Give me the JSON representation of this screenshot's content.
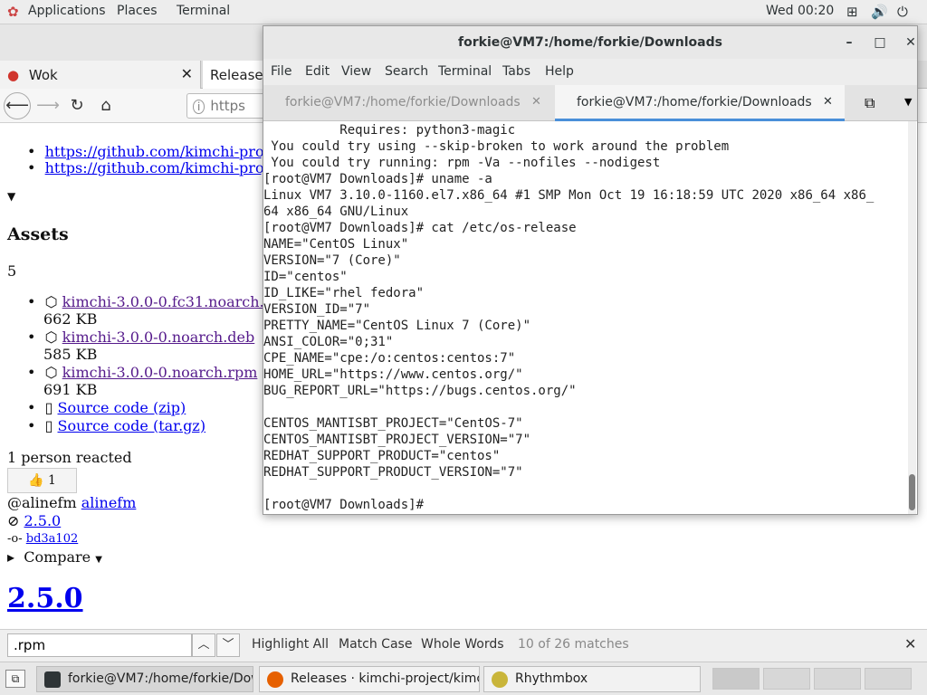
{
  "topbar": {
    "applications": "Applications",
    "places": "Places",
    "terminal": "Terminal",
    "clock": "Wed 00:20",
    "icons": [
      "network-icon",
      "volume-icon",
      "power-icon"
    ]
  },
  "browser": {
    "tabs": [
      {
        "label": "Wok"
      },
      {
        "label": "Releases"
      }
    ],
    "url_partial": "https",
    "content": {
      "links_top": [
        "https://github.com/kimchi-proj",
        "https://github.com/kimchi-proj"
      ],
      "assets_heading": "Assets",
      "assets_count": "5",
      "assets": [
        {
          "name": "kimchi-3.0.0-0.fc31.noarch.",
          "size": "662 KB"
        },
        {
          "name": "kimchi-3.0.0-0.noarch.deb",
          "size": "585 KB"
        },
        {
          "name": "kimchi-3.0.0-0.noarch.rpm",
          "size": "691 KB"
        }
      ],
      "source_zip": "Source code (zip)",
      "source_tar": "Source code (tar.gz)",
      "reacted": "1 person reacted",
      "reaction": "👍 1",
      "author_handle": "@alinefm",
      "author_link": "alinefm",
      "tag": "2.5.0",
      "commit": "bd3a102",
      "compare": "Compare",
      "release_heading": "2.5.0"
    }
  },
  "findbar": {
    "query": ".rpm",
    "highlight_all": "Highlight All",
    "match_case": "Match Case",
    "whole_words": "Whole Words",
    "matches": "10 of 26 matches"
  },
  "taskbar": {
    "tasks": [
      {
        "label": "forkie@VM7:/home/forkie/Dow...",
        "active": true
      },
      {
        "label": "Releases · kimchi-project/kimchi...",
        "active": false
      },
      {
        "label": "Rhythmbox",
        "active": false
      }
    ]
  },
  "terminal": {
    "title": "forkie@VM7:/home/forkie/Downloads",
    "menu": [
      "File",
      "Edit",
      "View",
      "Search",
      "Terminal",
      "Tabs",
      "Help"
    ],
    "tabs": [
      {
        "label": "forkie@VM7:/home/forkie/Downloads",
        "active": false
      },
      {
        "label": "forkie@VM7:/home/forkie/Downloads",
        "active": true
      }
    ],
    "lines": [
      "          Requires: python3-magic",
      " You could try using --skip-broken to work around the problem",
      " You could try running: rpm -Va --nofiles --nodigest",
      "[root@VM7 Downloads]# uname -a",
      "Linux VM7 3.10.0-1160.el7.x86_64 #1 SMP Mon Oct 19 16:18:59 UTC 2020 x86_64 x86_",
      "64 x86_64 GNU/Linux",
      "[root@VM7 Downloads]# cat /etc/os-release",
      "NAME=\"CentOS Linux\"",
      "VERSION=\"7 (Core)\"",
      "ID=\"centos\"",
      "ID_LIKE=\"rhel fedora\"",
      "VERSION_ID=\"7\"",
      "PRETTY_NAME=\"CentOS Linux 7 (Core)\"",
      "ANSI_COLOR=\"0;31\"",
      "CPE_NAME=\"cpe:/o:centos:centos:7\"",
      "HOME_URL=\"https://www.centos.org/\"",
      "BUG_REPORT_URL=\"https://bugs.centos.org/\"",
      "",
      "CENTOS_MANTISBT_PROJECT=\"CentOS-7\"",
      "CENTOS_MANTISBT_PROJECT_VERSION=\"7\"",
      "REDHAT_SUPPORT_PRODUCT=\"centos\"",
      "REDHAT_SUPPORT_PRODUCT_VERSION=\"7\"",
      "",
      "[root@VM7 Downloads]# "
    ]
  }
}
